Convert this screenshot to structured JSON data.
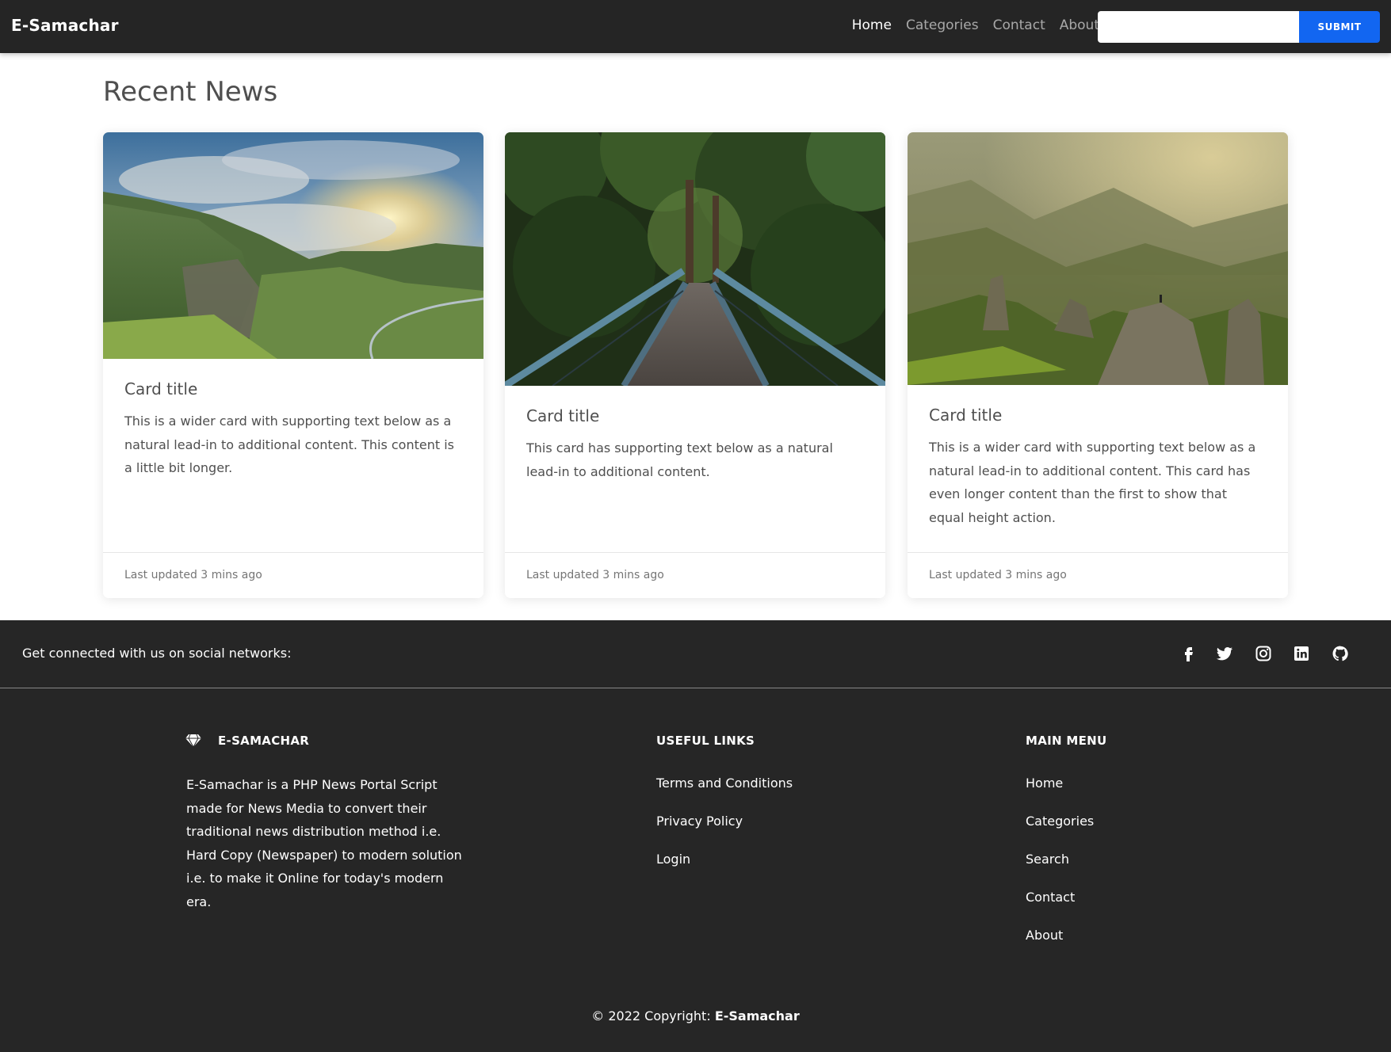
{
  "navbar": {
    "brand": "E-Samachar",
    "links": [
      "Home",
      "Categories",
      "Contact",
      "About"
    ],
    "search_placeholder": "",
    "submit_label": "SUBMIT"
  },
  "main": {
    "heading": "Recent News",
    "cards": [
      {
        "title": "Card title",
        "text": "This is a wider card with supporting text below as a natural lead-in to additional content. This content is a little bit longer.",
        "footer": "Last updated 3 mins ago",
        "image": "mountain-valley-sunset-image"
      },
      {
        "title": "Card title",
        "text": "This card has supporting text below as a natural lead-in to additional content.",
        "footer": "Last updated 3 mins ago",
        "image": "forest-bridge-image"
      },
      {
        "title": "Card title",
        "text": "This is a wider card with supporting text below as a natural lead-in to additional content. This card has even longer content than the first to show that equal height action.",
        "footer": "Last updated 3 mins ago",
        "image": "misty-mountains-image"
      }
    ]
  },
  "footer": {
    "social_text": "Get connected with us on social networks:",
    "social_icons": [
      "facebook-icon",
      "twitter-icon",
      "instagram-icon",
      "linkedin-icon",
      "github-icon"
    ],
    "brand_heading": "E-SAMACHAR",
    "brand_icon": "gem-icon",
    "brand_description": "E-Samachar is a PHP News Portal Script made for News Media to convert their traditional news distribution method i.e. Hard Copy (Newspaper) to modern solution i.e. to make it Online for today's modern era.",
    "useful_links_heading": "USEFUL LINKS",
    "useful_links": [
      "Terms and Conditions",
      "Privacy Policy",
      "Login"
    ],
    "main_menu_heading": "MAIN MENU",
    "main_menu": [
      "Home",
      "Categories",
      "Search",
      "Contact",
      "About"
    ],
    "copyright_prefix": "© 2022 Copyright:",
    "copyright_brand": "E-Samachar"
  },
  "colors": {
    "navbar_bg": "#252525",
    "footer_bg": "#262626",
    "accent": "#1266f1",
    "text": "#4f4f4f"
  }
}
